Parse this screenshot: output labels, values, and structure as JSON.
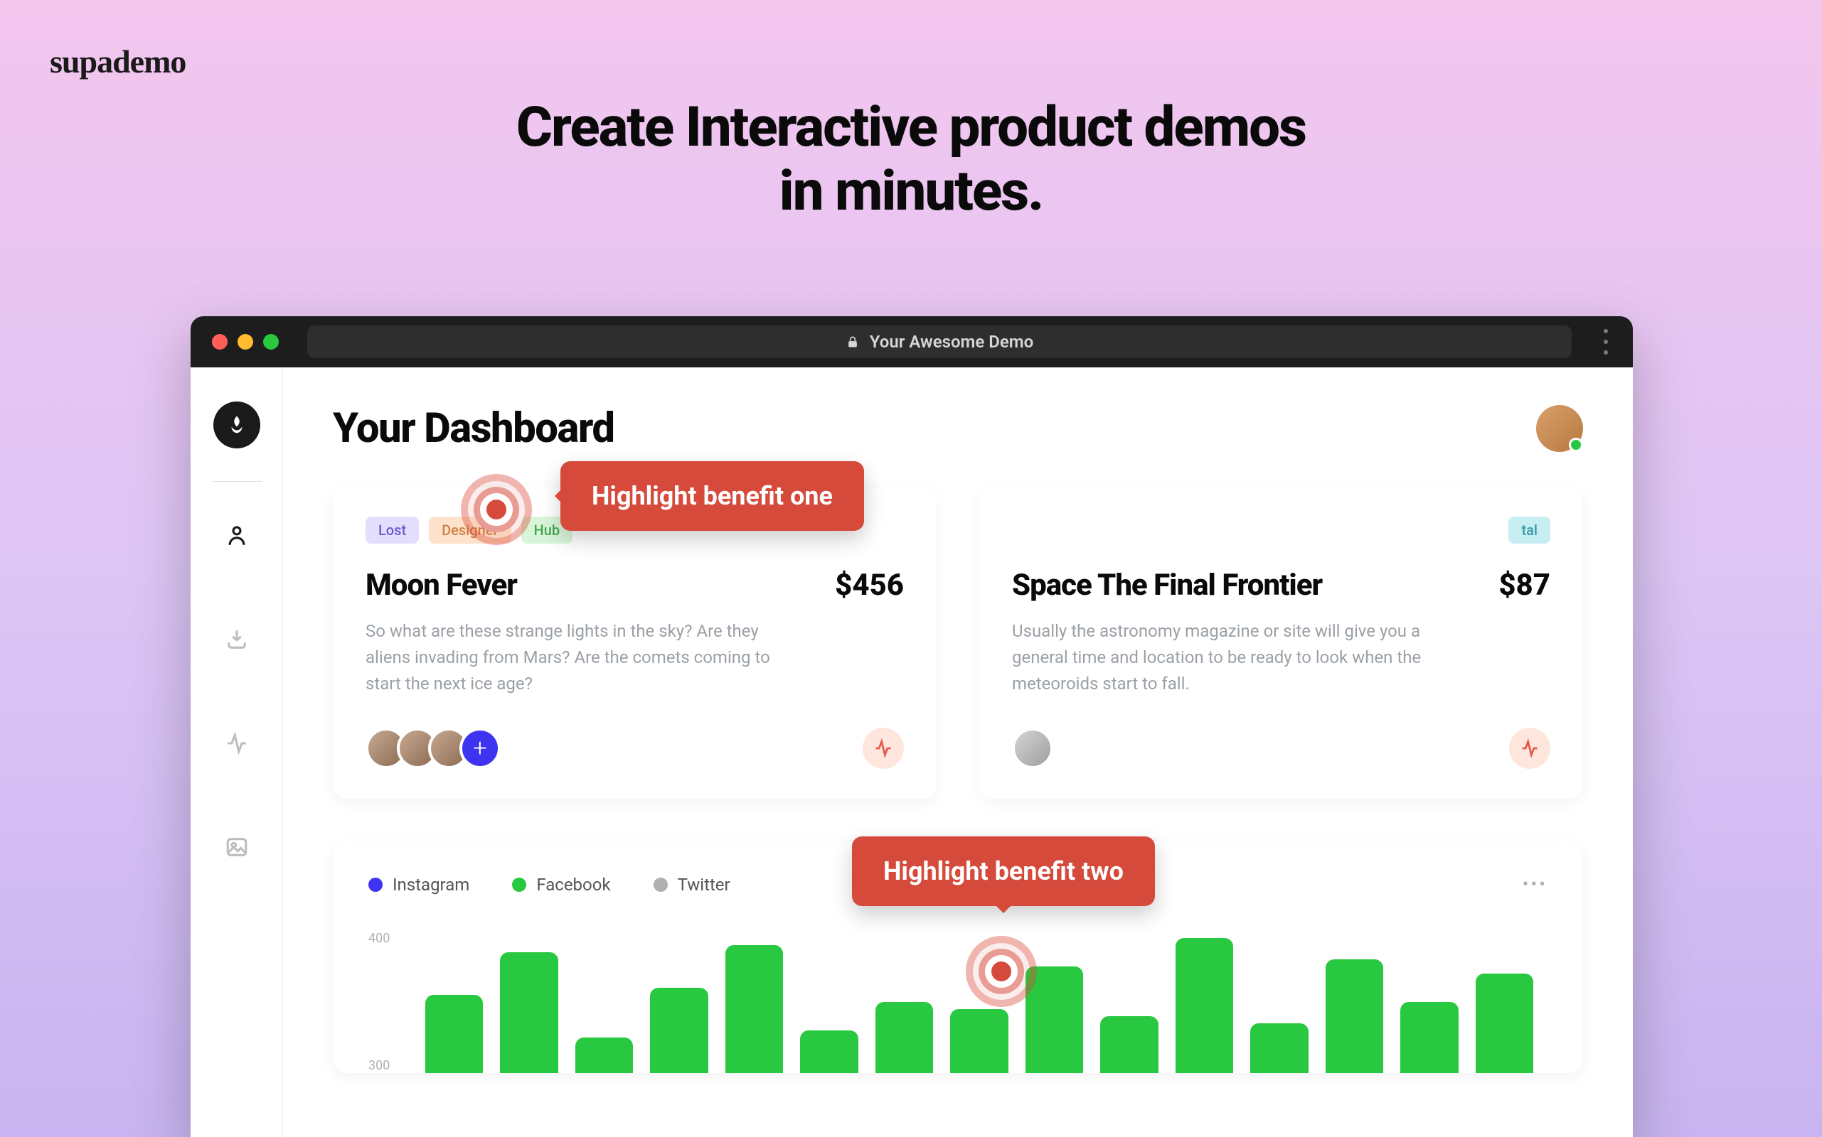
{
  "brand": "supademo",
  "headline_line1": "Create Interactive product demos",
  "headline_line2": "in minutes.",
  "browser": {
    "url_label": "Your Awesome Demo"
  },
  "dashboard": {
    "title": "Your Dashboard"
  },
  "card1": {
    "tags": [
      "Lost",
      "Designer",
      "Hub"
    ],
    "title": "Moon Fever",
    "price": "$456",
    "body": "So what are these strange lights in the sky? Are they aliens invading from Mars? Are the comets coming to start the next ice age?"
  },
  "card2": {
    "tag": "tal",
    "title": "Space The Final Frontier",
    "price": "$87",
    "body": "Usually the astronomy magazine or site will give you a general time and location to be ready to look when the meteoroids start to fall."
  },
  "tooltips": {
    "one": "Highlight benefit one",
    "two": "Highlight benefit two"
  },
  "chart_data": {
    "type": "bar",
    "legend": [
      "Instagram",
      "Facebook",
      "Twitter"
    ],
    "y_ticks": [
      400,
      300
    ],
    "bar_heights_pct": [
      55,
      85,
      25,
      60,
      90,
      30,
      50,
      45,
      75,
      40,
      95,
      35,
      80,
      50,
      70
    ]
  }
}
